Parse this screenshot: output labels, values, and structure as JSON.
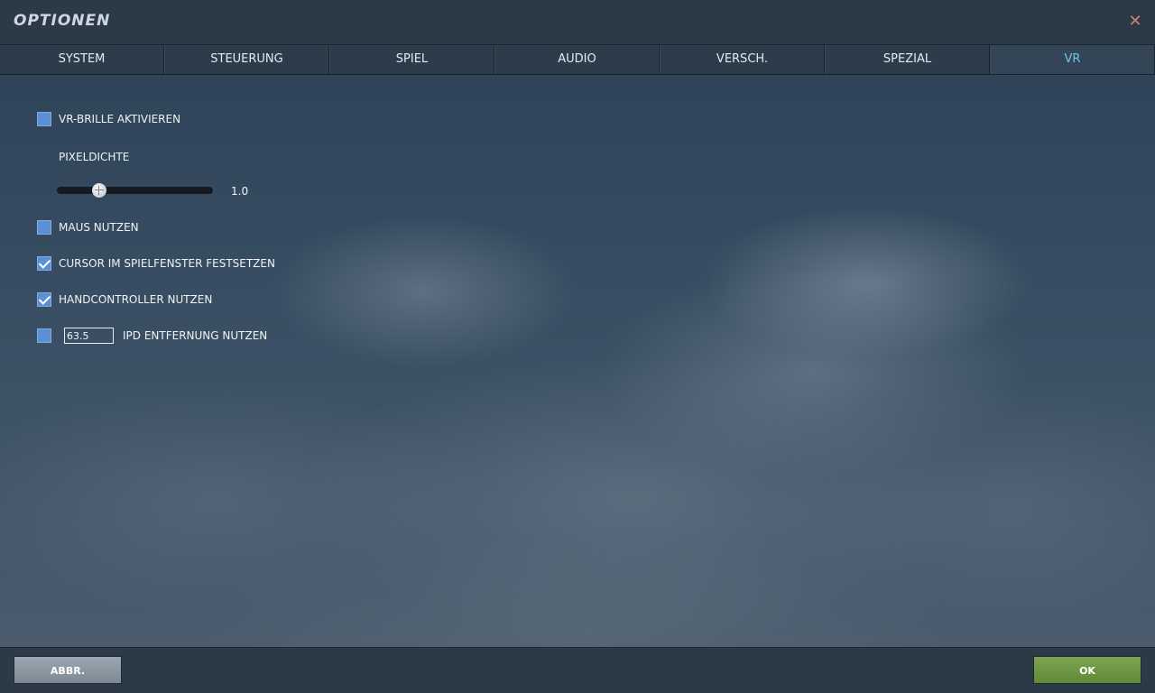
{
  "window": {
    "title": "OPTIONEN",
    "close_icon": "close-icon"
  },
  "tabs": [
    {
      "label": "SYSTEM",
      "active": false
    },
    {
      "label": "STEUERUNG",
      "active": false
    },
    {
      "label": "SPIEL",
      "active": false
    },
    {
      "label": "AUDIO",
      "active": false
    },
    {
      "label": "VERSCH.",
      "active": false
    },
    {
      "label": "SPEZIAL",
      "active": false
    },
    {
      "label": "VR",
      "active": true
    }
  ],
  "vr": {
    "enable_headset": {
      "label": "VR-BRILLE AKTIVIEREN",
      "checked": false
    },
    "pixel_density": {
      "label": "PIXELDICHTE",
      "value": "1.0",
      "level": 0.27
    },
    "use_mouse": {
      "label": "MAUS NUTZEN",
      "checked": false
    },
    "lock_cursor": {
      "label": "CURSOR IM SPIELFENSTER FESTSETZEN",
      "checked": true
    },
    "use_hand_controllers": {
      "label": "HANDCONTROLLER NUTZEN",
      "checked": true
    },
    "ipd": {
      "label": "IPD ENTFERNUNG NUTZEN",
      "value": "63.5",
      "checked": false
    }
  },
  "footer": {
    "cancel_label": "ABBR.",
    "ok_label": "OK"
  },
  "colors": {
    "active_tab": "#6fc6ea",
    "checkbox": "#5d8fd6",
    "ok_button": "#6c9744",
    "cancel_button": "#8b96a0",
    "close_icon": "#c9866d"
  }
}
